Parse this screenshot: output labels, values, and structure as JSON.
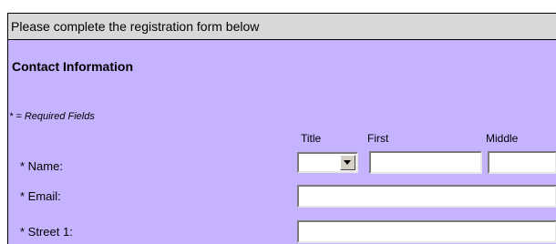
{
  "banner": {
    "text": "Please complete the registration form below"
  },
  "section": {
    "title": "Contact Information",
    "required_note": "* = Required Fields"
  },
  "name_columns": {
    "title": "Title",
    "first": "First",
    "middle": "Middle"
  },
  "fields": {
    "name_label": "* Name:",
    "email_label": "* Email:",
    "street1_label": "* Street 1:",
    "title_value": "",
    "first_value": "",
    "middle_value": "",
    "email_value": "",
    "street1_value": ""
  },
  "colors": {
    "form_background": "#c5b3ff",
    "banner_background": "#d8d8d8"
  }
}
